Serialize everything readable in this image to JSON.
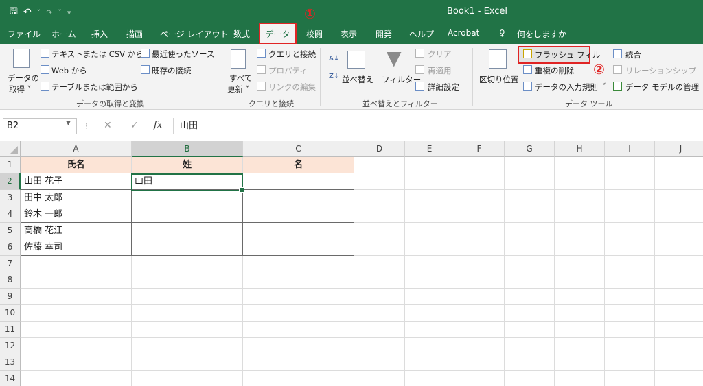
{
  "app": {
    "title": "Book1  -  Excel"
  },
  "qat": {
    "save": "🖫",
    "undo": "↶",
    "redo": "↷",
    "customize": "▾"
  },
  "tabs": [
    {
      "label": "ファイル"
    },
    {
      "label": "ホーム"
    },
    {
      "label": "挿入"
    },
    {
      "label": "描画"
    },
    {
      "label": "ページ レイアウト"
    },
    {
      "label": "数式"
    },
    {
      "label": "データ"
    },
    {
      "label": "校閲"
    },
    {
      "label": "表示"
    },
    {
      "label": "開発"
    },
    {
      "label": "ヘルプ"
    },
    {
      "label": "Acrobat"
    }
  ],
  "tell_me": "何をしますか",
  "annotations": {
    "one": "①",
    "two": "②"
  },
  "ribbon": {
    "get_data": {
      "get_data_line1": "データの",
      "get_data_line2": "取得 ˅",
      "from_text_csv": "テキストまたは CSV から",
      "from_web": "Web から",
      "from_table": "テーブルまたは範囲から",
      "recent_sources": "最近使ったソース",
      "existing_connections": "既存の接続",
      "group_label": "データの取得と変換"
    },
    "queries": {
      "refresh_line1": "すべて",
      "refresh_line2": "更新 ˅",
      "queries_connections": "クエリと接続",
      "properties": "プロパティ",
      "edit_links": "リンクの編集",
      "group_label": "クエリと接続"
    },
    "sort_filter": {
      "sort": "並べ替え",
      "filter": "フィルター",
      "clear": "クリア",
      "reapply": "再適用",
      "advanced": "詳細設定",
      "group_label": "並べ替えとフィルター"
    },
    "data_tools": {
      "text_to_columns": "区切り位置",
      "flash_fill": "フラッシュ フィル",
      "remove_duplicates": "重複の削除",
      "data_validation": "データの入力規則",
      "consolidate": "統合",
      "relationships": "リレーションシップ",
      "data_model": "データ モデルの管理",
      "group_label": "データ ツール"
    }
  },
  "formula_bar": {
    "name_box": "B2",
    "cancel": "✕",
    "enter": "✓",
    "fx": "fx",
    "value": "山田"
  },
  "grid": {
    "columns": [
      "A",
      "B",
      "C",
      "D",
      "E",
      "F",
      "G",
      "H",
      "I",
      "J"
    ],
    "rows": [
      "1",
      "2",
      "3",
      "4",
      "5",
      "6",
      "7",
      "8",
      "9",
      "10",
      "11",
      "12",
      "13",
      "14"
    ],
    "header_row": [
      "氏名",
      "姓",
      "名"
    ],
    "data": [
      [
        "山田 花子",
        "山田",
        ""
      ],
      [
        "田中 太郎",
        "",
        ""
      ],
      [
        "鈴木 一郎",
        "",
        ""
      ],
      [
        "高橋 花江",
        "",
        ""
      ],
      [
        "佐藤 幸司",
        "",
        ""
      ]
    ]
  }
}
